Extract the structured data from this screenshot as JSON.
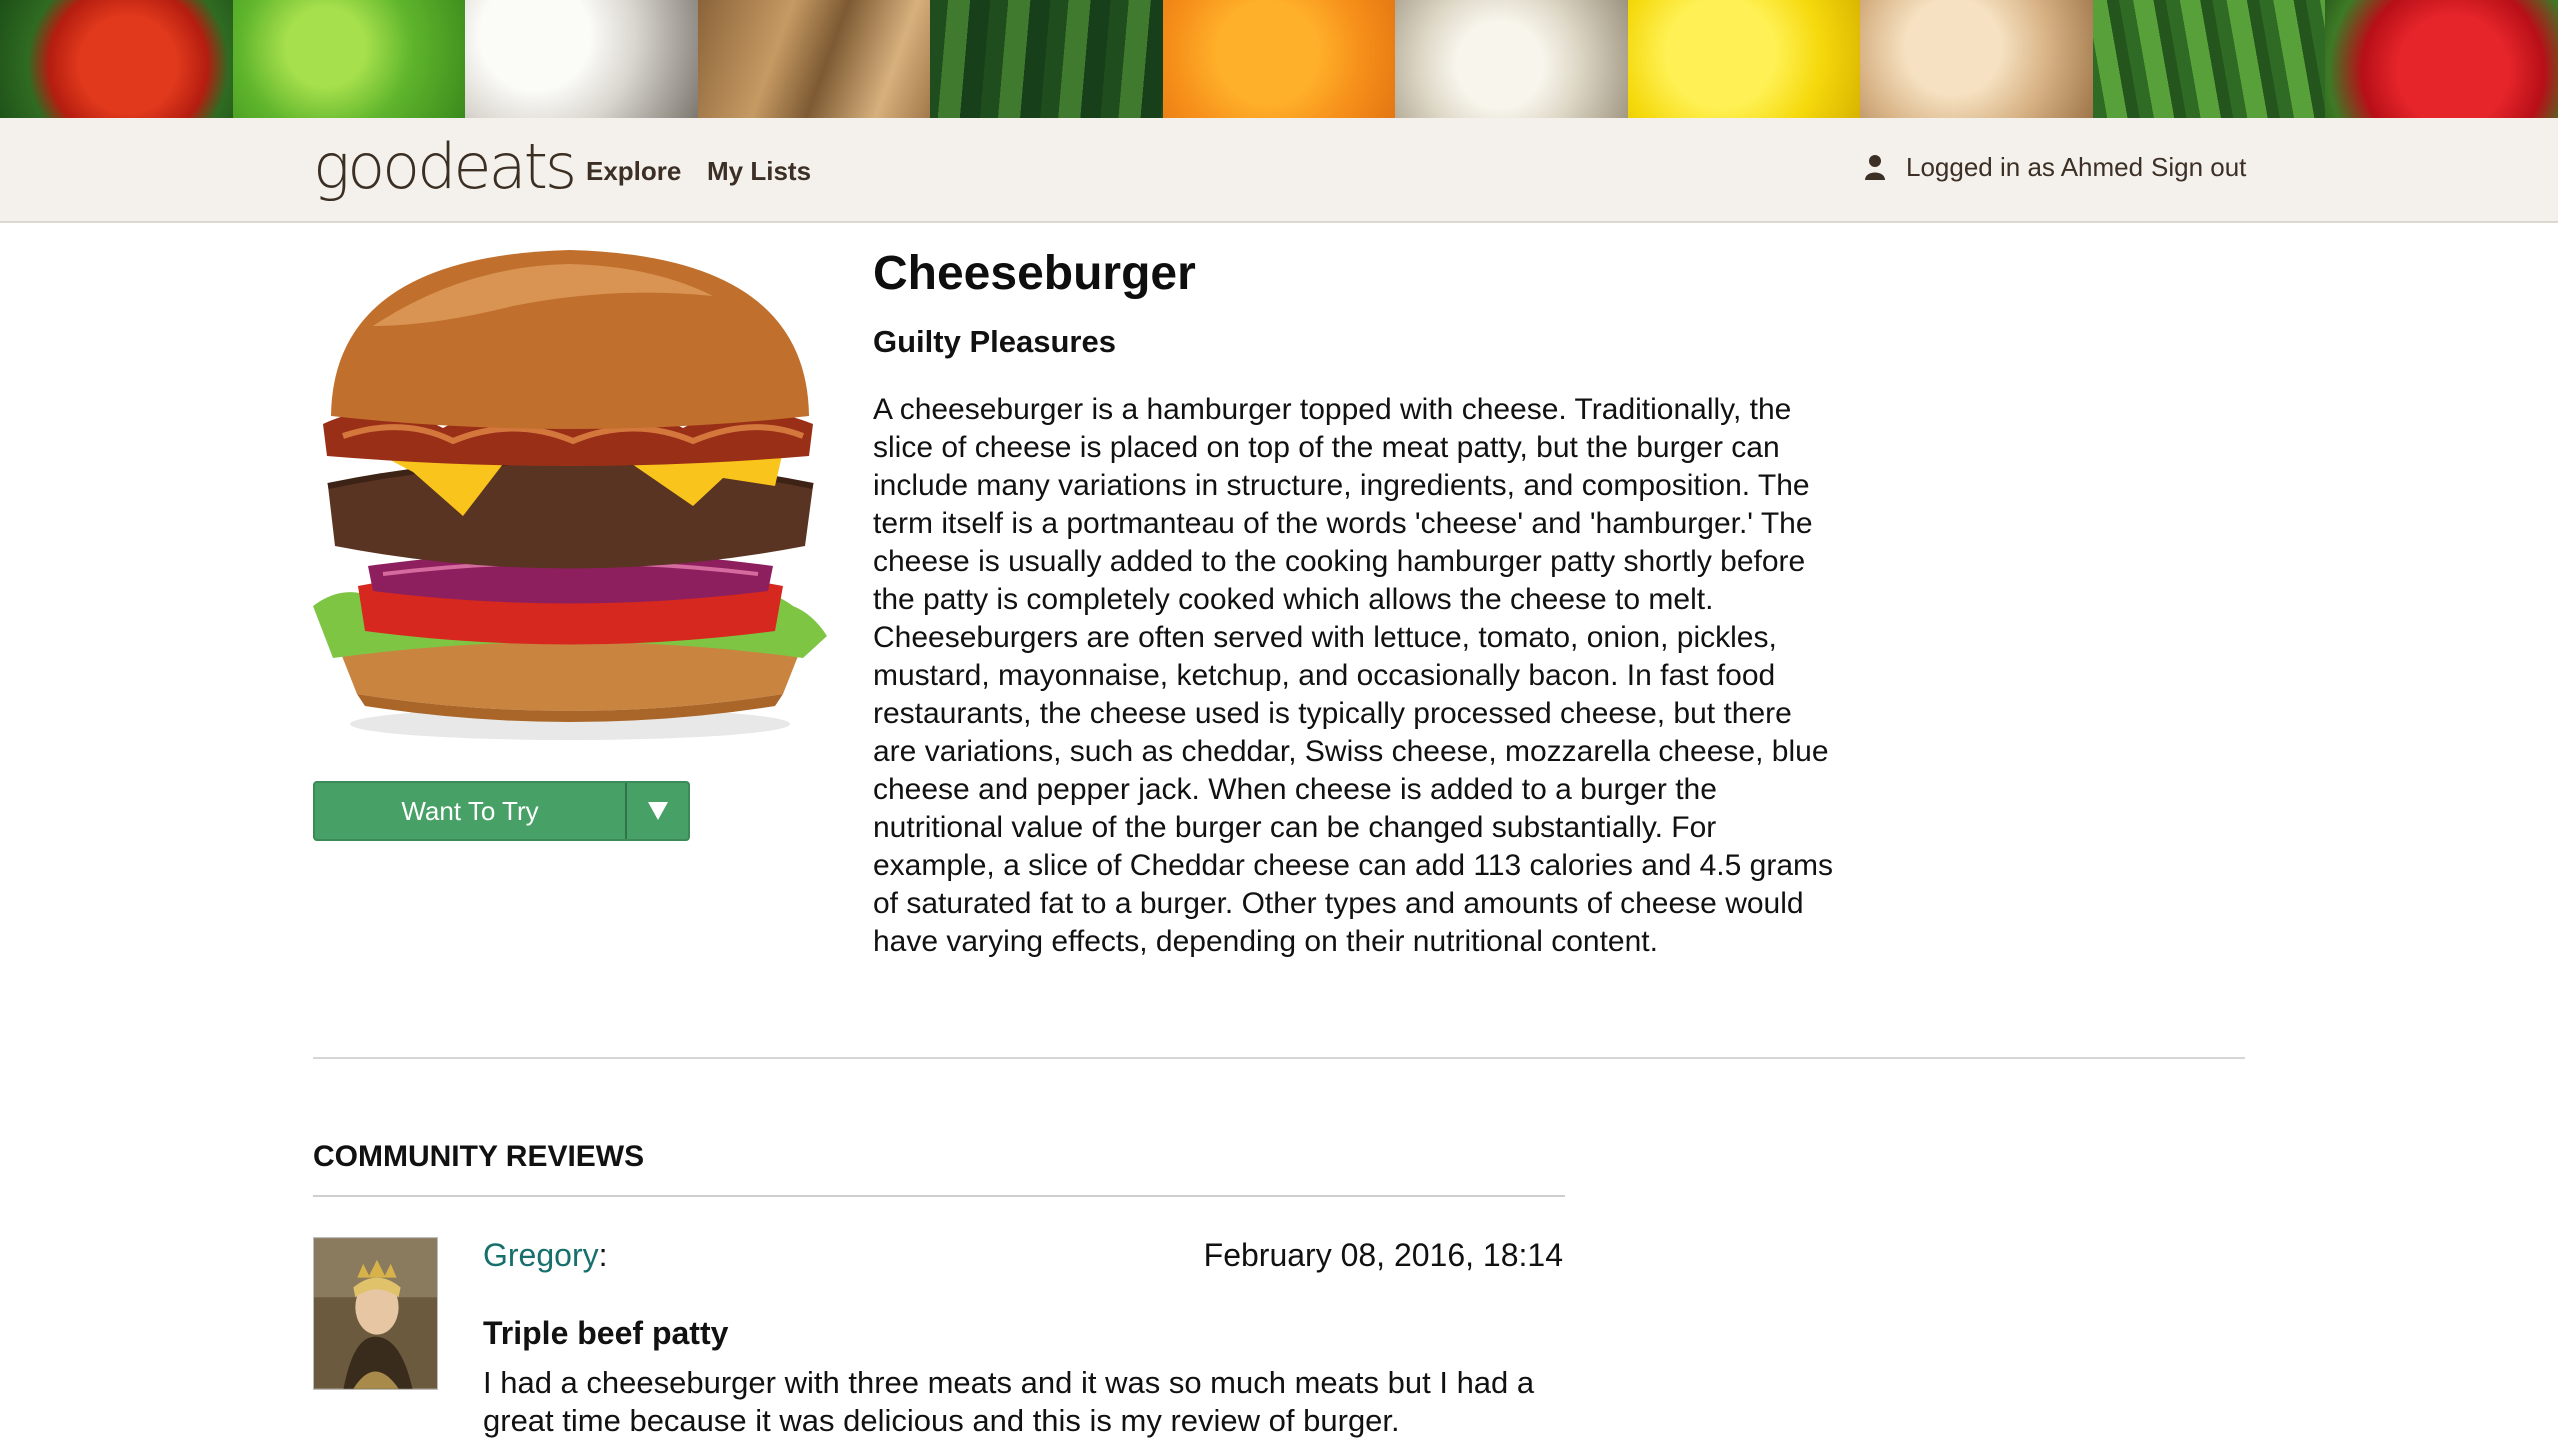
{
  "banner": {
    "tiles": [
      "tomato",
      "green-apple",
      "mushrooms",
      "potatoes",
      "cucumbers",
      "orange",
      "garlic",
      "lemon",
      "onion",
      "green-beans",
      "strawberries"
    ]
  },
  "nav": {
    "logo_text": "goodeats",
    "links": [
      {
        "label": "Explore"
      },
      {
        "label": "My Lists"
      }
    ],
    "user_icon": "user-icon",
    "logged_in_text": "Logged in as Ahmed",
    "sign_out": "Sign out"
  },
  "food": {
    "image": "cheeseburger-photo",
    "title": "Cheeseburger",
    "category": "Guilty Pleasures",
    "description": "A cheeseburger is a hamburger topped with cheese. Traditionally, the slice of cheese is placed on top of the meat patty, but the burger can include many variations in structure, ingredients, and composition. The term itself is a portmanteau of the words 'cheese' and 'hamburger.' The cheese is usually added to the cooking hamburger patty shortly before the patty is completely cooked which allows the cheese to melt. Cheeseburgers are often served with lettuce, tomato, onion, pickles, mustard, mayonnaise, ketchup, and occasionally bacon. In fast food restaurants, the cheese used is typically processed cheese, but there are variations, such as cheddar, Swiss cheese, mozzarella cheese, blue cheese and pepper jack. When cheese is added to a burger the nutritional value of the burger can be changed substantially. For example, a slice of Cheddar cheese can add 113 calories and 4.5 grams of saturated fat to a burger. Other types and amounts of cheese would have varying effects, depending on their nutritional content."
  },
  "want_button": {
    "label": "Want To Try",
    "dropdown_icon": "triangle-down-icon"
  },
  "colors": {
    "accent_green": "#47a066",
    "reviewer_link": "#17706b",
    "navbar_bg": "#f4f1ec"
  },
  "reviews": {
    "heading": "COMMUNITY REVIEWS",
    "items": [
      {
        "reviewer": "Gregory",
        "separator": ":",
        "date": "February 08, 2016, 18:14",
        "title": "Triple beef patty",
        "body": "I had a cheeseburger with three meats and it was so much meats but I had a great time because it was delicious and this is my review of burger."
      }
    ]
  }
}
